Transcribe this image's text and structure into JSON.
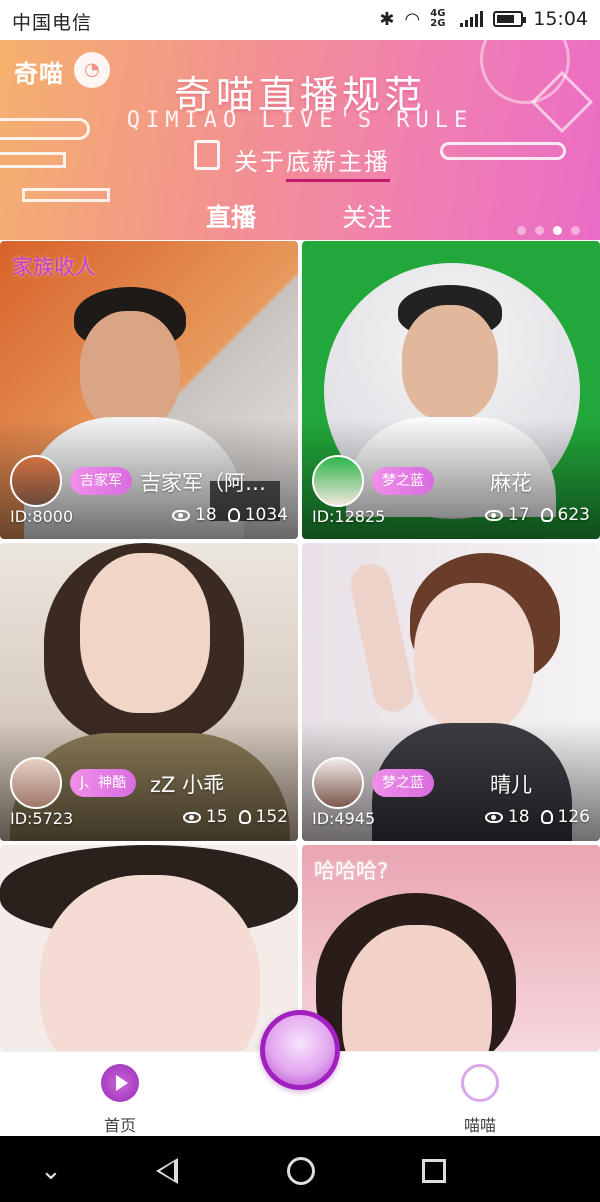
{
  "status_bar": {
    "carrier": "中国电信",
    "network": "4G 2G",
    "time": "15:04"
  },
  "banner": {
    "logo_text": "奇喵",
    "title": "奇喵直播规范",
    "subtitle": "QIMIAO LIVE'S RULE",
    "tagline_prefix": "关于",
    "tagline_highlight": "底薪主播"
  },
  "tabs": [
    {
      "label": "直播",
      "active": true
    },
    {
      "label": "关注",
      "active": false
    }
  ],
  "carousel": {
    "count": 4,
    "active_index": 2
  },
  "streams": [
    {
      "family_tag": "家族收人",
      "badge": "吉家军",
      "name": "吉家军（阿…",
      "id": "ID:8000",
      "viewers": "18",
      "likes": "1034",
      "bg": "#e07a3a"
    },
    {
      "family_tag": "",
      "badge": "梦之蓝",
      "name": "麻花",
      "id": "ID:12825",
      "viewers": "17",
      "likes": "623",
      "bg": "#22a83a"
    },
    {
      "family_tag": "",
      "badge": "J、神酷",
      "name": "zZ 小乖",
      "id": "ID:5723",
      "viewers": "15",
      "likes": "152",
      "bg": "#e8ddd6"
    },
    {
      "family_tag": "",
      "badge": "梦之蓝",
      "name": "晴儿",
      "id": "ID:4945",
      "viewers": "18",
      "likes": "126",
      "bg": "#f1ecee"
    },
    {
      "family_tag": "",
      "badge": "",
      "name": "",
      "id": "",
      "viewers": "",
      "likes": "",
      "bg": "#f3ece9"
    },
    {
      "family_tag": "哈哈哈?",
      "badge": "",
      "name": "",
      "id": "",
      "viewers": "",
      "likes": "",
      "bg": "#f2c9c9"
    }
  ],
  "bottom_nav": {
    "home_label": "首页",
    "miao_label": "喵喵"
  },
  "icons": [
    "wifi-icon",
    "bluetooth-icon",
    "battery-icon",
    "eye-icon",
    "bulb-icon",
    "play-icon",
    "cat-icon",
    "back-icon",
    "home-icon",
    "recents-icon"
  ]
}
